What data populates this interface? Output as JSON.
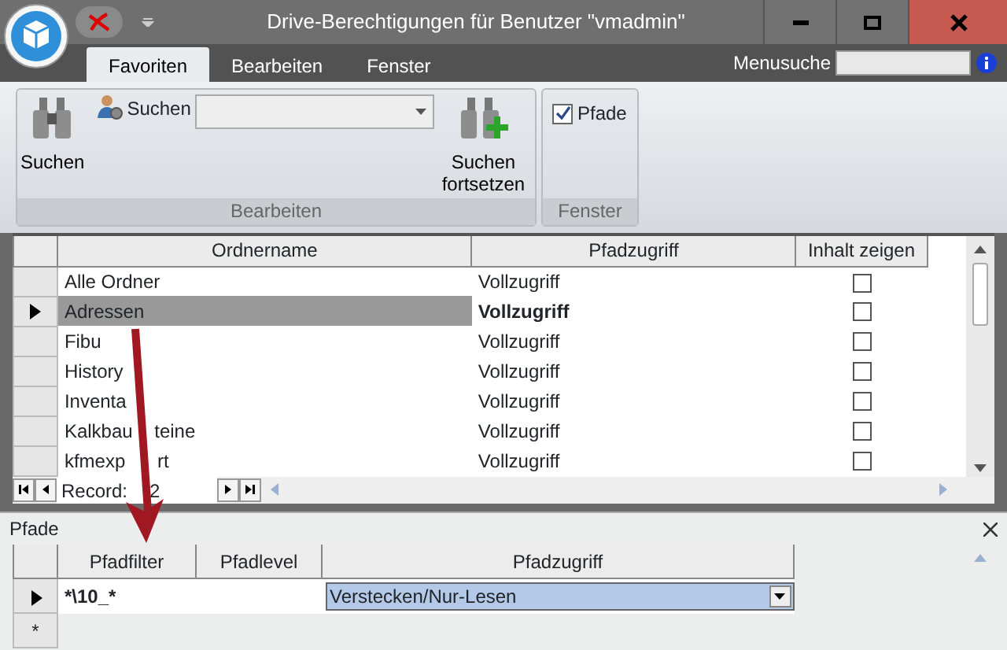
{
  "window": {
    "title": "Drive-Berechtigungen für Benutzer \"vmadmin\""
  },
  "tabs": [
    {
      "label": "Favoriten",
      "selected": true
    },
    {
      "label": "Bearbeiten",
      "selected": false
    },
    {
      "label": "Fenster",
      "selected": false
    }
  ],
  "menu_search": {
    "label": "Menusuche"
  },
  "ribbon": {
    "groups": [
      {
        "label": "Bearbeiten",
        "search_label": "Suchen",
        "search_button": "Suchen",
        "continue_button": "Suchen fortsetzen"
      },
      {
        "label": "Fenster",
        "checkbox": {
          "label": "Pfade",
          "checked": true
        }
      }
    ]
  },
  "folders": {
    "columns": [
      "Ordnername",
      "Pfadzugriff",
      "Inhalt zeigen"
    ],
    "rows": [
      {
        "name": "Alle Ordner",
        "access": "Vollzugriff",
        "show_content": false,
        "selected": false
      },
      {
        "name": "Adressen",
        "access": "Vollzugriff",
        "show_content": false,
        "selected": true
      },
      {
        "name": "Fibu",
        "access": "Vollzugriff",
        "show_content": false,
        "selected": false
      },
      {
        "name": "History",
        "access": "Vollzugriff",
        "show_content": false,
        "selected": false
      },
      {
        "name": "Inventa",
        "access": "Vollzugriff",
        "show_content": false,
        "selected": false
      },
      {
        "name": "Kalkbau",
        "name_after_arrow": "teine",
        "access": "Vollzugriff",
        "show_content": false,
        "selected": false
      },
      {
        "name": "kfmexp",
        "name_after_arrow": "rt",
        "access": "Vollzugriff",
        "show_content": false,
        "selected": false
      }
    ],
    "navigator": {
      "label": "Record:",
      "value": "2"
    }
  },
  "paths": {
    "title": "Pfade",
    "columns": [
      "Pfadfilter",
      "Pfadlevel",
      "Pfadzugriff"
    ],
    "rows": [
      {
        "filter": "*\\10_*",
        "access": "Verstecken/Nur-Lesen",
        "selected": true
      }
    ],
    "new_row_marker": "*"
  }
}
